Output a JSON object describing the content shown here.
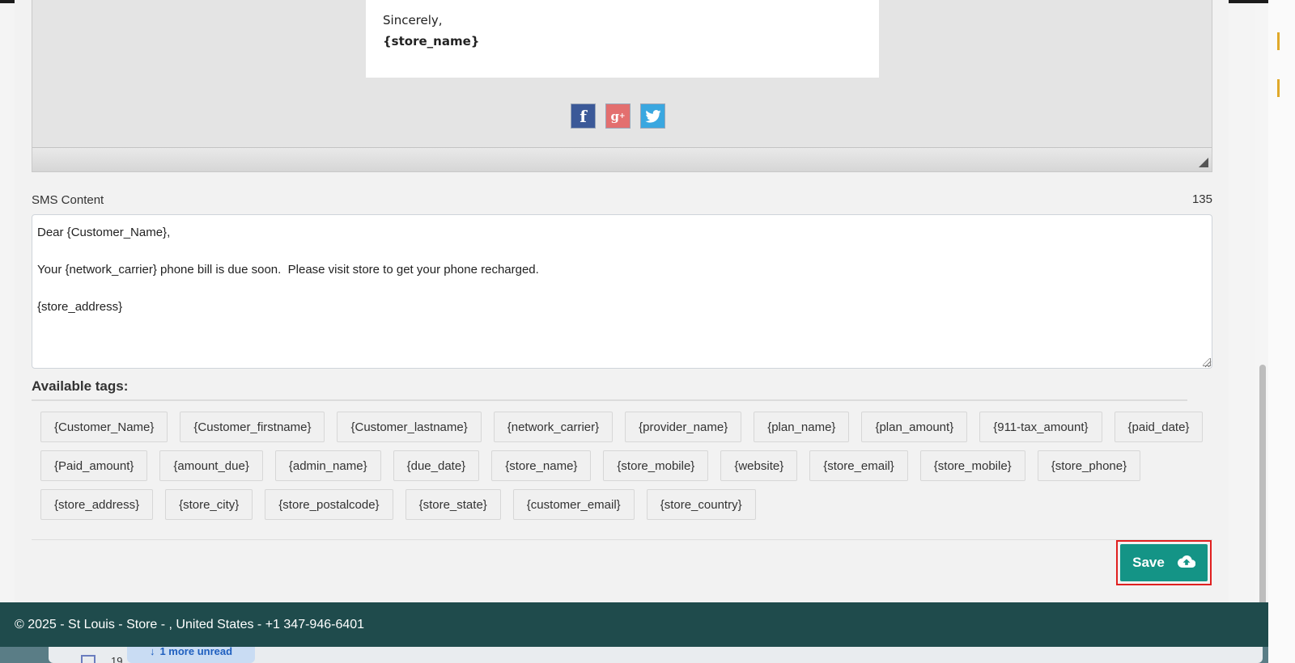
{
  "email_preview": {
    "closing": "Sincerely,",
    "store_tag": "{store_name}",
    "social_icons": [
      "facebook-icon",
      "google-plus-icon",
      "twitter-icon"
    ]
  },
  "sms": {
    "label": "SMS Content",
    "char_count": "135",
    "content": "Dear {Customer_Name},\n\nYour {network_carrier} phone bill is due soon.  Please visit store to get your phone recharged.\n\n{store_address}"
  },
  "tags": {
    "title": "Available tags:",
    "items": [
      "{Customer_Name}",
      "{Customer_firstname}",
      "{Customer_lastname}",
      "{network_carrier}",
      "{provider_name}",
      "{plan_name}",
      "{plan_amount}",
      "{911-tax_amount}",
      "{paid_date}",
      "{Paid_amount}",
      "{amount_due}",
      "{admin_name}",
      "{due_date}",
      "{store_name}",
      "{store_mobile}",
      "{website}",
      "{store_email}",
      "{store_mobile}",
      "{store_phone}",
      "{store_address}",
      "{store_city}",
      "{store_postalcode}",
      "{store_state}",
      "{customer_email}",
      "{store_country}"
    ]
  },
  "actions": {
    "save_label": "Save",
    "save_icon": "cloud-upload-icon"
  },
  "footer": {
    "text": "© 2025 - St Louis - Store - , United States - +1 347-946-6401"
  },
  "background_app": {
    "unread_label": "1 more unread",
    "partial_number": "19"
  },
  "colors": {
    "accent": "#149486",
    "footer_bg": "#1f4b4c",
    "highlight_outline": "#e02020"
  }
}
